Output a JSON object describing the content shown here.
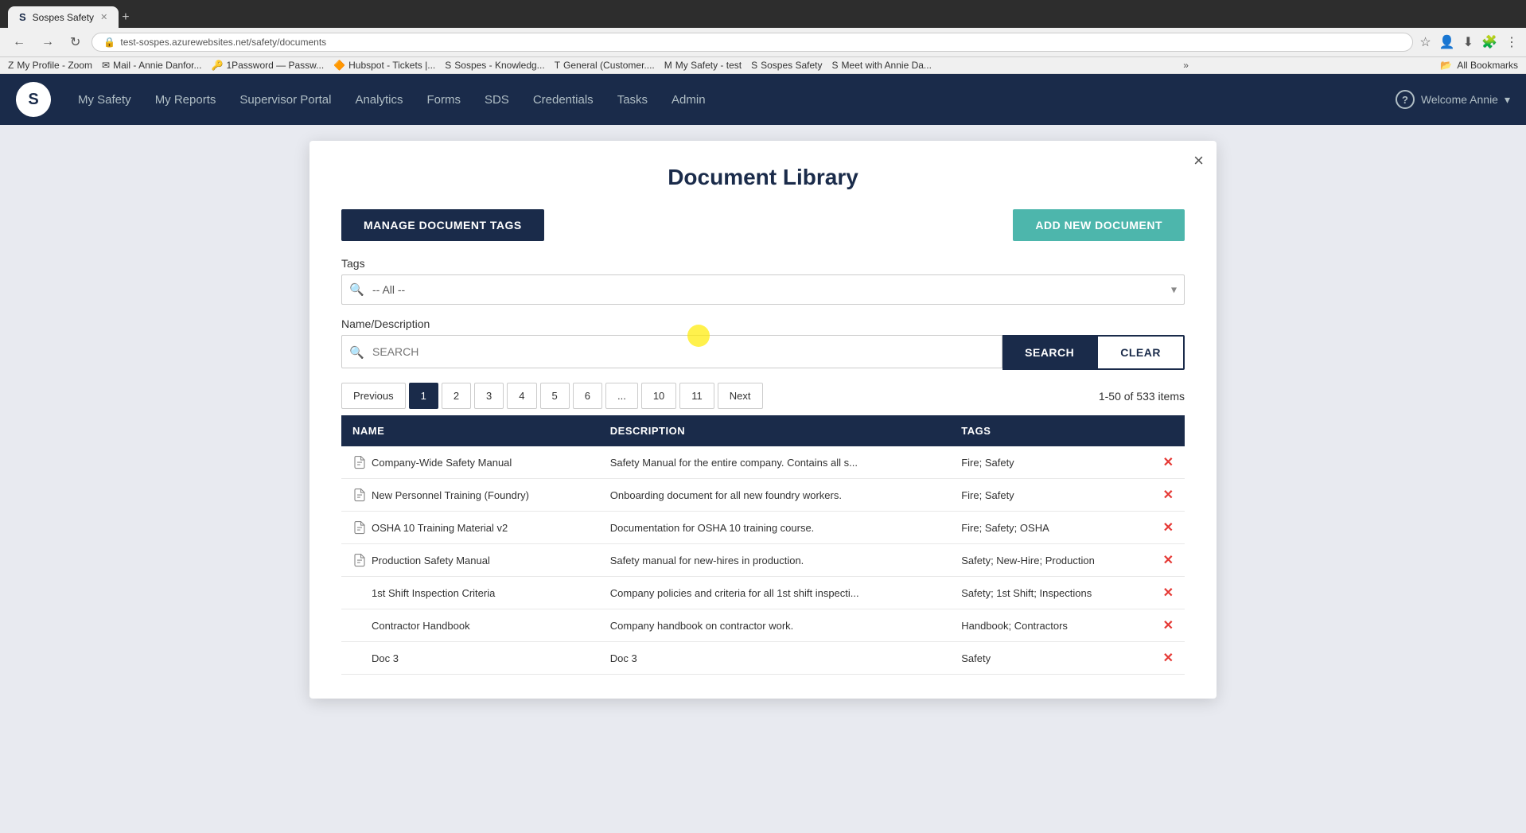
{
  "browser": {
    "tabs": [
      {
        "label": "Sospes Safety",
        "active": true,
        "favicon": "S"
      },
      {
        "label": "+",
        "active": false,
        "isNew": true
      }
    ],
    "address": "test-sospes.azurewebsites.net/safety/documents",
    "bookmarks": [
      {
        "label": "My Profile - Zoom",
        "icon": "Z"
      },
      {
        "label": "Mail - Annie Danfor...",
        "icon": "M"
      },
      {
        "label": "1Password — Passw...",
        "icon": "1"
      },
      {
        "label": "Hubspot - Tickets |...",
        "icon": "H"
      },
      {
        "label": "Sospes - Knowledg...",
        "icon": "S"
      },
      {
        "label": "General (Customer....",
        "icon": "G"
      },
      {
        "label": "My Safety - test",
        "icon": "M"
      },
      {
        "label": "Sospes Safety",
        "icon": "S"
      },
      {
        "label": "Meet with Annie Da...",
        "icon": "S"
      }
    ],
    "bookmark_more": "»",
    "all_bookmarks": "All Bookmarks"
  },
  "navbar": {
    "logo": "S",
    "links": [
      {
        "label": "My Safety",
        "active": false
      },
      {
        "label": "My Reports",
        "active": false
      },
      {
        "label": "Supervisor Portal",
        "active": false
      },
      {
        "label": "Analytics",
        "active": false
      },
      {
        "label": "Forms",
        "active": false
      },
      {
        "label": "SDS",
        "active": false
      },
      {
        "label": "Credentials",
        "active": false
      },
      {
        "label": "Tasks",
        "active": false
      },
      {
        "label": "Admin",
        "active": false
      }
    ],
    "user": "Welcome Annie",
    "help_icon": "?"
  },
  "modal": {
    "title": "Document Library",
    "close_label": "×",
    "manage_tags_label": "MANAGE DOCUMENT TAGS",
    "add_document_label": "ADD NEW DOCUMENT",
    "tags_section": {
      "label": "Tags",
      "placeholder": "-- All --"
    },
    "search_section": {
      "label": "Name/Description",
      "placeholder": "SEARCH",
      "search_btn": "SEARCH",
      "clear_btn": "CLEAR"
    },
    "pagination": {
      "previous": "Previous",
      "next": "Next",
      "pages": [
        "1",
        "2",
        "3",
        "4",
        "5",
        "6",
        "...",
        "10",
        "11"
      ],
      "active_page": "1",
      "items_count": "1-50 of 533 items"
    },
    "table": {
      "headers": [
        "NAME",
        "DESCRIPTION",
        "TAGS"
      ],
      "rows": [
        {
          "name": "Company-Wide Safety Manual",
          "description": "Safety Manual for the entire company. Contains all s...",
          "tags": "Fire; Safety",
          "has_icon": true
        },
        {
          "name": "New Personnel Training (Foundry)",
          "description": "Onboarding document for all new foundry workers.",
          "tags": "Fire; Safety",
          "has_icon": true
        },
        {
          "name": "OSHA 10 Training Material v2",
          "description": "Documentation for OSHA 10 training course.",
          "tags": "Fire; Safety; OSHA",
          "has_icon": true
        },
        {
          "name": "Production Safety Manual",
          "description": "Safety manual for new-hires in production.",
          "tags": "Safety; New-Hire; Production",
          "has_icon": true
        },
        {
          "name": "1st Shift Inspection Criteria",
          "description": "Company policies and criteria for all 1st shift inspecti...",
          "tags": "Safety; 1st Shift; Inspections",
          "has_icon": false
        },
        {
          "name": "Contractor Handbook",
          "description": "Company handbook on contractor work.",
          "tags": "Handbook; Contractors",
          "has_icon": false
        },
        {
          "name": "Doc 3",
          "description": "Doc 3",
          "tags": "Safety",
          "has_icon": false
        }
      ]
    }
  }
}
